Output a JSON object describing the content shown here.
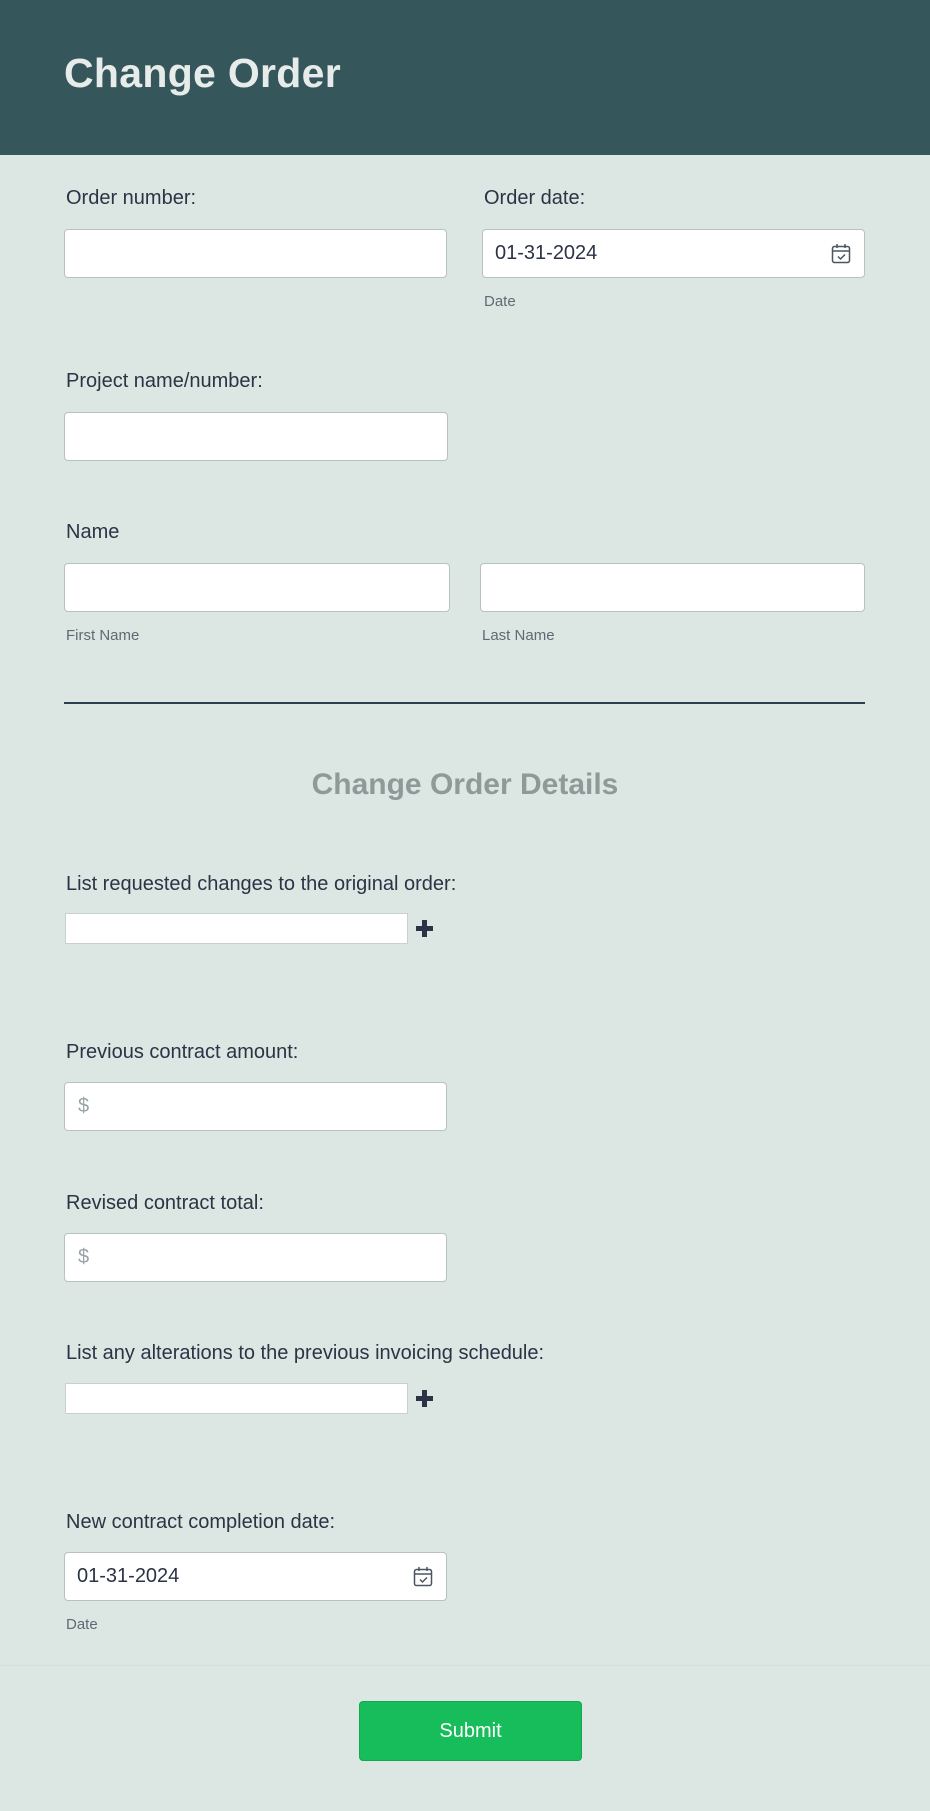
{
  "header": {
    "title": "Change Order"
  },
  "fields": {
    "order_number": {
      "label": "Order number:",
      "value": ""
    },
    "order_date": {
      "label": "Order date:",
      "value": "01-31-2024",
      "sublabel": "Date"
    },
    "project": {
      "label": "Project name/number:",
      "value": ""
    },
    "name": {
      "label": "Name",
      "first_sublabel": "First Name",
      "last_sublabel": "Last Name"
    }
  },
  "details": {
    "title": "Change Order Details",
    "requested_changes": {
      "label": "List requested changes to the original order:"
    },
    "previous_amount": {
      "label": "Previous contract amount:",
      "currency": "$"
    },
    "revised_total": {
      "label": "Revised contract total:",
      "currency": "$"
    },
    "alterations": {
      "label": "List any alterations to the previous invoicing schedule:"
    },
    "completion_date": {
      "label": "New contract completion date:",
      "value": "01-31-2024",
      "sublabel": "Date"
    }
  },
  "submit": {
    "label": "Submit"
  },
  "colors": {
    "header_bg": "#35565b",
    "page_bg": "#dce6e3",
    "submit_bg": "#18bd5b"
  },
  "icons": [
    "calendar-icon",
    "plus-icon"
  ]
}
